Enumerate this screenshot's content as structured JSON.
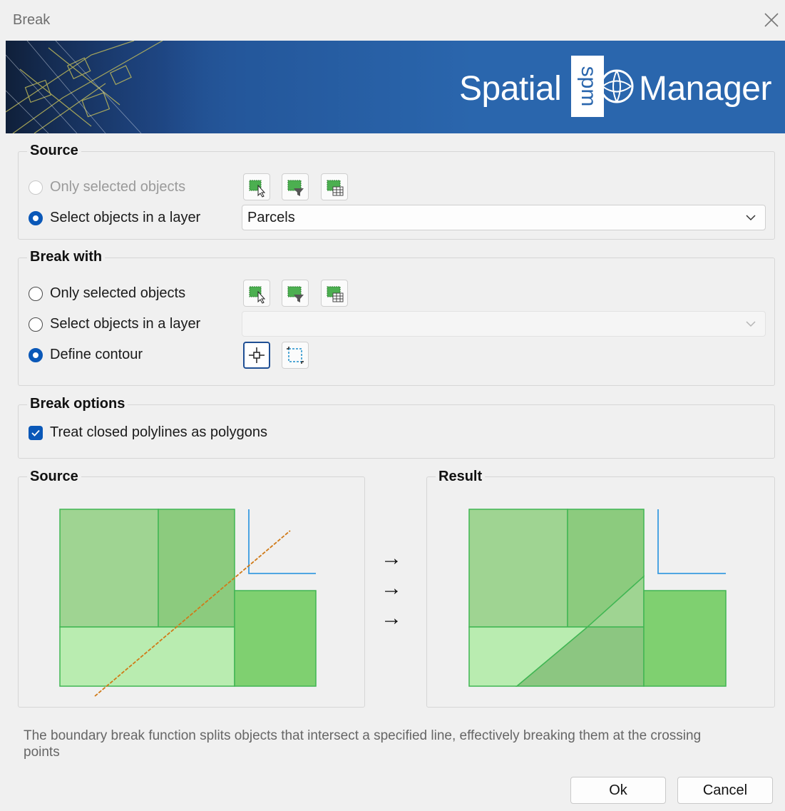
{
  "window": {
    "title": "Break"
  },
  "banner": {
    "brand_left": "Spatial",
    "brand_right": "Manager",
    "logo_text": "spm"
  },
  "source_group": {
    "legend": "Source",
    "options": [
      "Only selected objects",
      "Select objects in a layer"
    ],
    "selected_option": "Select objects in a layer",
    "tools": [
      "select-objects-icon",
      "filter-objects-icon",
      "table-select-icon"
    ],
    "layer_value": "Parcels"
  },
  "break_with_group": {
    "legend": "Break with",
    "options": [
      "Only selected objects",
      "Select objects in a layer",
      "Define contour"
    ],
    "selected_option": "Define contour",
    "tools": [
      "select-objects-icon",
      "filter-objects-icon",
      "table-select-icon"
    ],
    "layer_value": "",
    "contour_tools": [
      "pick-point-icon",
      "rectangle-icon"
    ]
  },
  "break_options_group": {
    "legend": "Break options",
    "treat_polygons_label": "Treat closed polylines as polygons",
    "treat_polygons_checked": true
  },
  "preview": {
    "source_label": "Source",
    "result_label": "Result",
    "arrows": [
      "→",
      "→",
      "→"
    ],
    "colors": {
      "light": "#b9ecb0",
      "mid": "#9bd48e",
      "dark": "#7ecf6e",
      "darker": "#8cc681",
      "stroke": "#33b54a",
      "cut_line": "#d07a18",
      "blue_line": "#3a9be0"
    }
  },
  "description": "The boundary break function splits objects that intersect a specified line, effectively breaking them at the crossing points",
  "buttons": {
    "ok": "Ok",
    "cancel": "Cancel"
  }
}
